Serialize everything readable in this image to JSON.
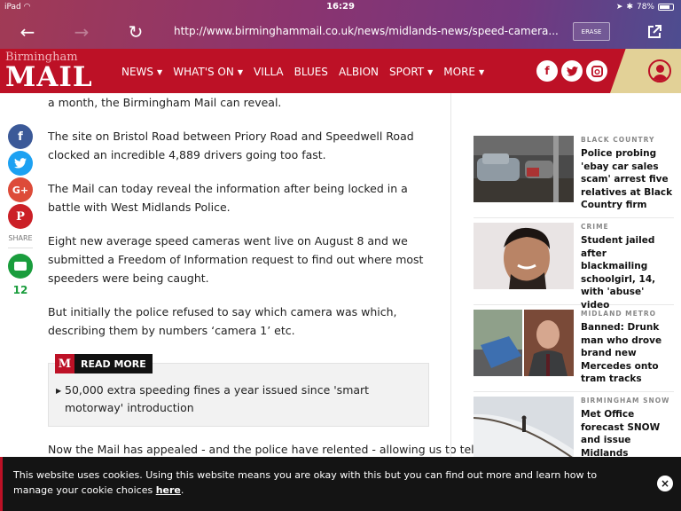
{
  "status_bar": {
    "device": "iPad",
    "time": "16:29",
    "battery": "78%",
    "battery_level": 0.78
  },
  "browser": {
    "url": "http://www.birminghammail.co.uk/news/midlands-news/speed-camera...",
    "erase_label": "ERASE",
    "icons": {
      "back": "←",
      "forward": "→",
      "reload": "↻",
      "share": "⇱"
    }
  },
  "header": {
    "logo_small": "Birmingham",
    "logo_big": "MAIL",
    "menu": [
      {
        "label": "NEWS",
        "dropdown": true
      },
      {
        "label": "WHAT'S ON",
        "dropdown": true
      },
      {
        "label": "VILLA",
        "dropdown": false
      },
      {
        "label": "BLUES",
        "dropdown": false
      },
      {
        "label": "ALBION",
        "dropdown": false
      },
      {
        "label": "SPORT",
        "dropdown": true
      },
      {
        "label": "MORE",
        "dropdown": true
      }
    ],
    "caret": "▼",
    "social": {
      "facebook": "f",
      "twitter": "t",
      "instagram": "◙"
    }
  },
  "share": {
    "facebook": "f",
    "twitter": "t",
    "googleplus": "G+",
    "pinterest": "P",
    "label": "SHARE",
    "comment_count": "12",
    "colors": {
      "facebook": "#3b5998",
      "twitter": "#1da1f2",
      "googleplus": "#dd4b39",
      "pinterest": "#cb2027",
      "comments": "#1a9d3d"
    }
  },
  "article": {
    "paragraphs": [
      "a month, the Birmingham Mail can reveal.",
      "The site on Bristol Road between Priory Road and Speedwell Road clocked an incredible 4,889 drivers going too fast.",
      "The Mail can today reveal the information after being locked in a battle with West Midlands Police.",
      "Eight new average speed cameras went live on August 8 and we submitted a Freedom of Information request to find out where most speeders were being caught.",
      "But initially the police refused to say which camera was which, describing them by numbers ‘camera 1’ etc."
    ],
    "read_more": {
      "badge": "M",
      "label": "READ MORE",
      "link": "50,000 extra speeding fines a year issued since 'smart motorway' introduction"
    },
    "tail": "Now the Mail has appealed - and the police have relented - allowing us to tell"
  },
  "sidebar": {
    "items": [
      {
        "category": "BLACK COUNTRY",
        "title": "Police probing 'ebay car sales scam' arrest five relatives at Black Country firm"
      },
      {
        "category": "CRIME",
        "title": "Student jailed after blackmailing schoolgirl, 14, with 'abuse' video"
      },
      {
        "category": "MIDLAND METRO",
        "title": "Banned: Drunk man who drove brand new Mercedes onto tram tracks"
      },
      {
        "category": "BIRMINGHAM SNOW",
        "title": "Met Office forecast SNOW and issue Midlands weather warning"
      }
    ]
  },
  "cookie": {
    "text": "This website uses cookies. Using this website means you are okay with this but you can find out more and learn how to manage your cookie choices ",
    "link": "here",
    "end": ".",
    "close": "×"
  }
}
